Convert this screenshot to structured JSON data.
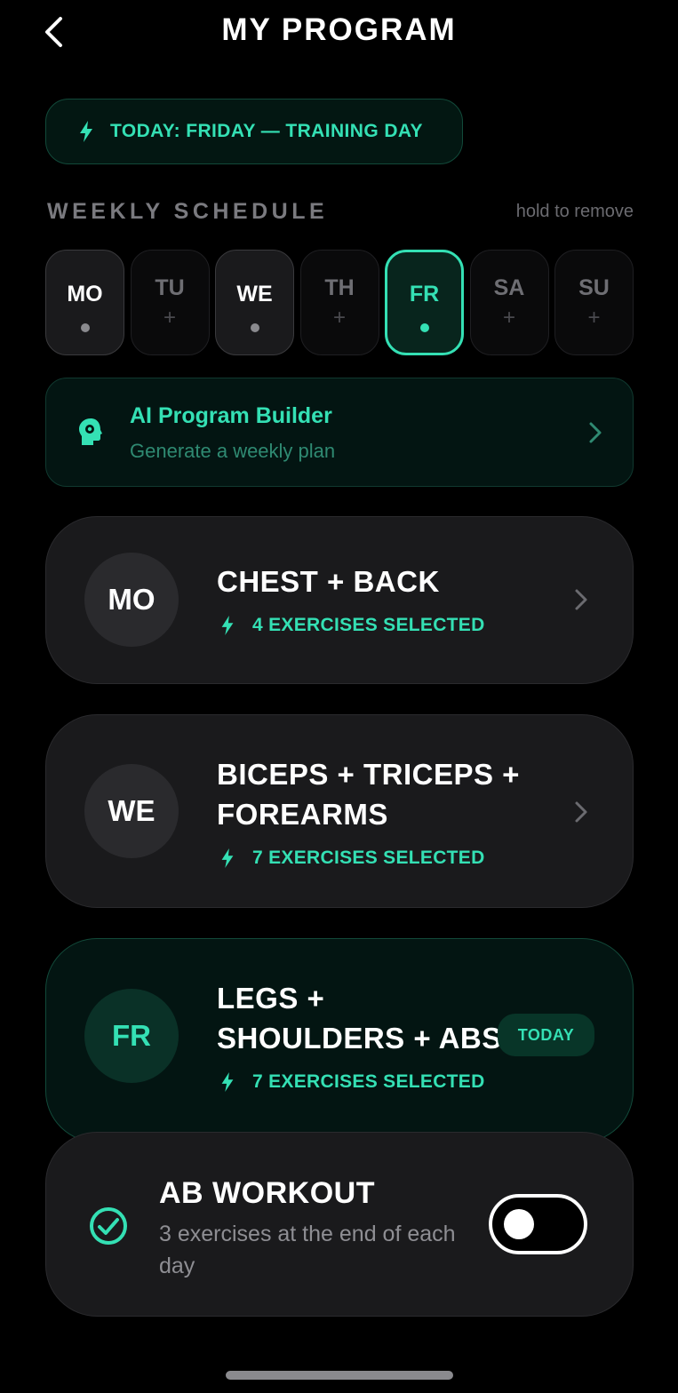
{
  "header": {
    "title": "MY PROGRAM",
    "back_icon": "chevron-left-icon"
  },
  "today_banner": {
    "text": "TODAY: FRIDAY — TRAINING DAY",
    "icon": "bolt-icon"
  },
  "schedule": {
    "title": "WEEKLY SCHEDULE",
    "hint": "hold to remove",
    "days": [
      {
        "abbr": "MO",
        "state": "filled",
        "mark": ""
      },
      {
        "abbr": "TU",
        "state": "empty",
        "mark": "+"
      },
      {
        "abbr": "WE",
        "state": "filled",
        "mark": ""
      },
      {
        "abbr": "TH",
        "state": "empty",
        "mark": "+"
      },
      {
        "abbr": "FR",
        "state": "active",
        "mark": ""
      },
      {
        "abbr": "SA",
        "state": "empty",
        "mark": "+"
      },
      {
        "abbr": "SU",
        "state": "empty",
        "mark": "+"
      }
    ]
  },
  "ai_builder": {
    "title": "AI Program Builder",
    "subtitle": "Generate a weekly plan",
    "icon": "ai-head-icon"
  },
  "workouts": [
    {
      "day": "MO",
      "title_lines": [
        "CHEST + BACK"
      ],
      "exercises": "4 EXERCISES SELECTED"
    },
    {
      "day": "WE",
      "title_lines": [
        "BICEPS + TRICEPS +",
        "FOREARMS"
      ],
      "exercises": "7 EXERCISES SELECTED"
    },
    {
      "day": "FR",
      "title_lines": [
        "LEGS +",
        "SHOULDERS + ABS"
      ],
      "exercises": "7 EXERCISES SELECTED",
      "badge": "TODAY"
    }
  ],
  "ab_workout": {
    "title": "AB WORKOUT",
    "subtitle": "3 exercises at the end of each day",
    "enabled": false
  },
  "colors": {
    "accent": "#34e0b4",
    "background": "#000000",
    "card": "#1a1a1c"
  }
}
